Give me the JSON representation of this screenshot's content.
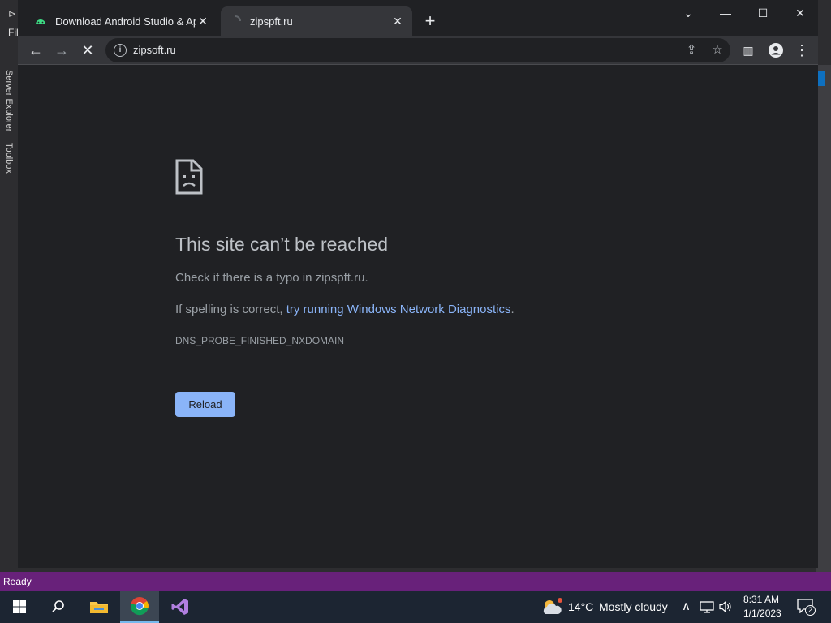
{
  "vs": {
    "file_menu": "Fil",
    "server_explorer": "Server Explorer",
    "toolbox": "Toolbox",
    "status": "Ready"
  },
  "browser": {
    "tabs": [
      {
        "title": "Download Android Studio & App",
        "icon": "android-icon",
        "active": false
      },
      {
        "title": "zipspft.ru",
        "icon": "loading-icon",
        "active": true
      }
    ],
    "new_tab": "+",
    "address": "zipsoft.ru",
    "window_controls": [
      "chevron-down-icon",
      "minimize-icon",
      "maximize-icon",
      "close-icon"
    ]
  },
  "error": {
    "title": "This site can’t be reached",
    "line1": "Check if there is a typo in zipspft.ru.",
    "line2_prefix": "If spelling is correct, ",
    "line2_link": "try running Windows Network Diagnostics",
    "line2_suffix": ".",
    "code": "DNS_PROBE_FINISHED_NXDOMAIN",
    "reload": "Reload"
  },
  "taskbar": {
    "weather_temp": "14°C",
    "weather_desc": "Mostly cloudy",
    "time": "8:31 AM",
    "date": "1/1/2023",
    "notifications": "2"
  },
  "colors": {
    "vs_status": "#68217a",
    "link": "#8ab4f8",
    "button": "#8ab4f8"
  }
}
